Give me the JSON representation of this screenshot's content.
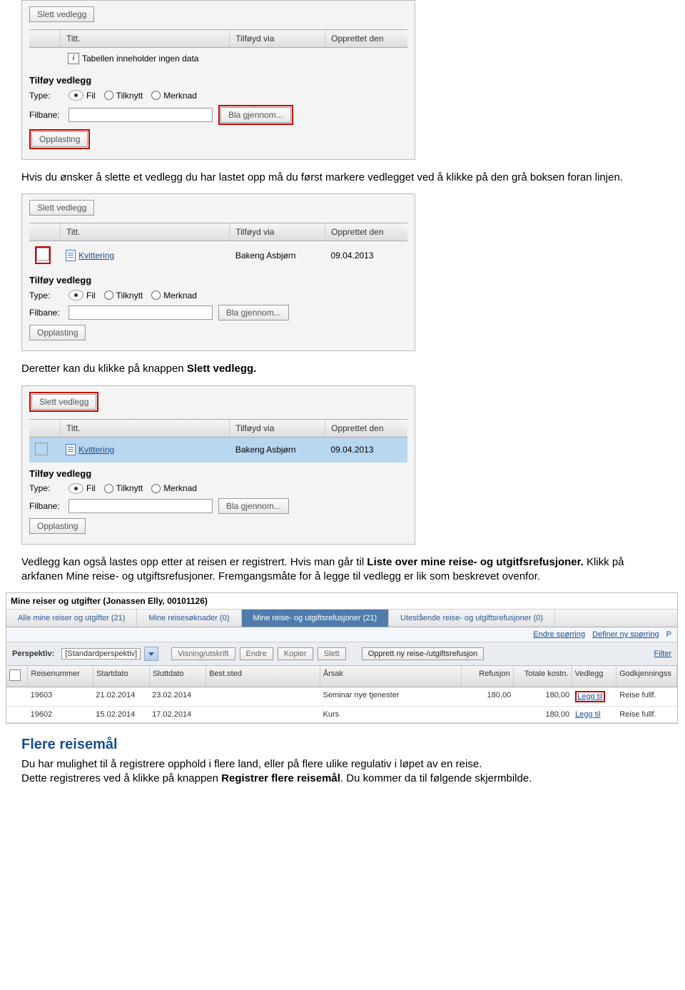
{
  "panel1": {
    "slett_btn": "Slett vedlegg",
    "cols": {
      "titt": "Titt.",
      "via": "Tilføyd via",
      "date": "Opprettet den"
    },
    "empty_msg": "Tabellen inneholder ingen data",
    "subhead": "Tilføy vedlegg",
    "type_label": "Type:",
    "type_opts": {
      "fil": "Fil",
      "tilknytt": "Tilknytt",
      "merknad": "Merknad"
    },
    "filbane_label": "Filbane:",
    "browse_btn": "Bla gjennom...",
    "upload_btn": "Opplasting"
  },
  "para1": "Hvis du ønsker å slette et vedlegg du har lastet opp må du først markere vedlegget ved å klikke på den grå boksen foran linjen.",
  "panel2": {
    "slett_btn": "Slett vedlegg",
    "cols": {
      "titt": "Titt.",
      "via": "Tilføyd via",
      "date": "Opprettet den"
    },
    "row": {
      "title": "Kvittering",
      "via": "Bakeng Asbjørn",
      "date": "09.04.2013"
    },
    "subhead": "Tilføy vedlegg",
    "type_label": "Type:",
    "type_opts": {
      "fil": "Fil",
      "tilknytt": "Tilknytt",
      "merknad": "Merknad"
    },
    "filbane_label": "Filbane:",
    "browse_btn": "Bla gjennom...",
    "upload_btn": "Opplasting"
  },
  "para2_a": "Deretter kan du klikke på knappen ",
  "para2_b": "Slett vedlegg.",
  "panel3": {
    "slett_btn": "Slett vedlegg",
    "cols": {
      "titt": "Titt.",
      "via": "Tilføyd via",
      "date": "Opprettet den"
    },
    "row": {
      "title": "Kvittering",
      "via": "Bakeng Asbjørn",
      "date": "09.04.2013"
    },
    "subhead": "Tilføy vedlegg",
    "type_label": "Type:",
    "type_opts": {
      "fil": "Fil",
      "tilknytt": "Tilknytt",
      "merknad": "Merknad"
    },
    "filbane_label": "Filbane:",
    "browse_btn": "Bla gjennom...",
    "upload_btn": "Opplasting"
  },
  "para3_a": "Vedlegg kan også lastes opp etter at reisen er registrert. Hvis man går til ",
  "para3_b": "Liste over mine reise- og utgitfsrefusjoner.",
  "para3_c": " Klikk på arkfanen Mine reise- og utgiftsrefusjoner. Fremgangsmåte for å legge til vedlegg er lik som beskrevet ovenfor.",
  "grid": {
    "title": "Mine reiser og utgifter (Jonassen Elly, 00101126)",
    "tabs": [
      "Alle mine reiser og utgifter (21)",
      "Mine reisesøknader (0)",
      "Mine reise- og utgiftsrefusjoner (21)",
      "Utestående reise- og utgiftsrefusjoner (0)"
    ],
    "query_links": {
      "endre": "Endre spørring",
      "definer": "Definer ny spørring",
      "p": "P"
    },
    "toolbar": {
      "perspektiv_lbl": "Perspektiv:",
      "perspektiv_val": "[Standardperspektiv]",
      "visning": "Visning/utskrift",
      "endre": "Endre",
      "kopier": "Kopier",
      "slett": "Slett",
      "opprett": "Opprett ny reise-/utgiftsrefusjon",
      "filter": "Filter"
    },
    "cols": {
      "nr": "Reisenummer",
      "start": "Startdato",
      "slutt": "Sluttdato",
      "best": "Best.sted",
      "arsak": "Årsak",
      "ref": "Refusjon",
      "tot": "Totale kostn.",
      "ved": "Vedlegg",
      "god": "Godkjenningss"
    },
    "rows": [
      {
        "nr": "19603",
        "start": "21.02.2014",
        "slutt": "23.02.2014",
        "best": "",
        "arsak": "Seminar nye tjenester",
        "ref": "180,00",
        "tot": "180,00",
        "ved": "Legg til",
        "god": "Reise fullf."
      },
      {
        "nr": "19602",
        "start": "15.02.2014",
        "slutt": "17.02.2014",
        "best": "",
        "arsak": "Kurs",
        "ref": "",
        "tot": "180,00",
        "ved": "Legg til",
        "god": "Reise fullf."
      }
    ]
  },
  "heading2": "Flere reisemål",
  "para4_a": "Du har mulighet til å registrere opphold i flere land, eller på flere ulike regulativ i løpet av en reise.",
  "para4_b": "Dette registreres ved å klikke på knappen ",
  "para4_c": "Registrer flere reisemål",
  "para4_d": ". Du kommer da til følgende skjermbilde."
}
